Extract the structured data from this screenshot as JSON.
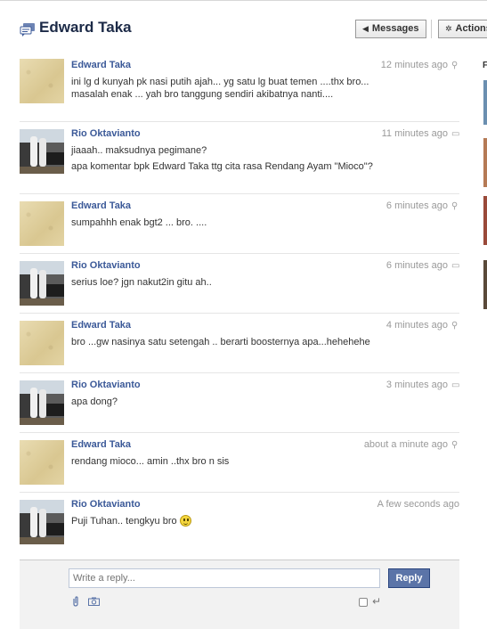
{
  "header": {
    "title": "Edward Taka",
    "messages_label": "Messages",
    "actions_label": "Actions"
  },
  "messages": [
    {
      "sender": "Edward Taka",
      "time": "12 minutes ago",
      "lines": [
        "ini lg d kunyah pk nasi putih ajah... yg satu lg buat temen ....thx bro... masalah enak ... yah bro tanggung sendiri akibatnya nanti...."
      ]
    },
    {
      "sender": "Rio Oktavianto",
      "time": "11 minutes ago",
      "lines": [
        "jiaaah.. maksudnya pegimane?",
        "apa komentar bpk Edward Taka ttg cita rasa Rendang Ayam \"Mioco\"?"
      ]
    },
    {
      "sender": "Edward Taka",
      "time": "6 minutes ago",
      "lines": [
        "sumpahhh enak bgt2 ... bro. ...."
      ]
    },
    {
      "sender": "Rio Oktavianto",
      "time": "6 minutes ago",
      "lines": [
        "serius loe? jgn nakut2in gitu ah.."
      ]
    },
    {
      "sender": "Edward Taka",
      "time": "4 minutes ago",
      "lines": [
        "bro ...gw nasinya satu setengah .. berarti boosternya apa...hehehehe"
      ]
    },
    {
      "sender": "Rio Oktavianto",
      "time": "3 minutes ago",
      "lines": [
        "apa dong?"
      ]
    },
    {
      "sender": "Edward Taka",
      "time": "about a minute ago",
      "lines": [
        "rendang mioco... amin ..thx bro n sis"
      ]
    },
    {
      "sender": "Rio Oktavianto",
      "time": "A few seconds ago",
      "lines": [
        "Puji Tuhan.. tengkyu bro"
      ]
    }
  ],
  "reply": {
    "placeholder": "Write a reply...",
    "button_label": "Reply"
  },
  "right_panel": {
    "label": "F"
  }
}
